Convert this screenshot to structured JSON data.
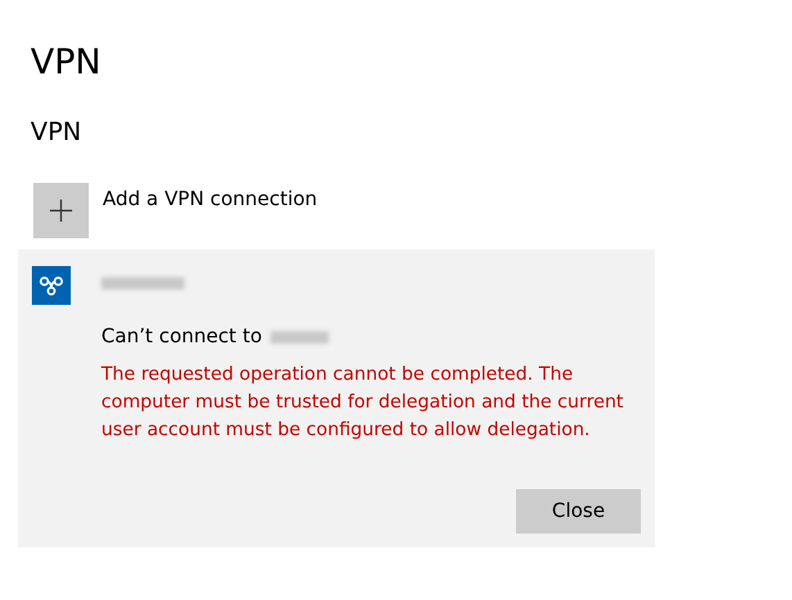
{
  "page_title": "VPN",
  "section_title": "VPN",
  "add_connection": {
    "label": "Add a VPN connection"
  },
  "connection": {
    "status_prefix": "Can’t connect to",
    "error": "The requested operation cannot be completed. The computer must be trusted for delegation and the current user account must be configured to allow delegation.",
    "button": "Close"
  }
}
